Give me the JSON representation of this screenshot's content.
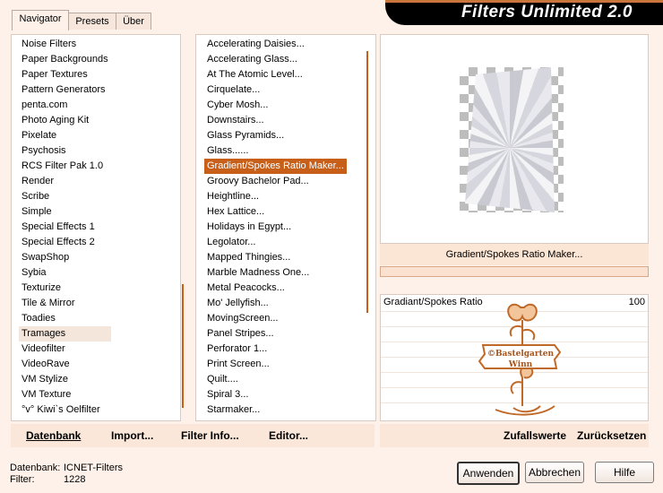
{
  "title": "Filters Unlimited 2.0",
  "tabs": [
    {
      "label": "Navigator",
      "active": true
    },
    {
      "label": "Presets",
      "active": false
    },
    {
      "label": "Über",
      "active": false
    }
  ],
  "categories": [
    "Noise Filters",
    "Paper Backgrounds",
    "Paper Textures",
    "Pattern Generators",
    "penta.com",
    "Photo Aging Kit",
    "Pixelate",
    "Psychosis",
    "RCS Filter Pak 1.0",
    "Render",
    "Scribe",
    "Simple",
    "Special Effects 1",
    "Special Effects 2",
    "SwapShop",
    "Sybia",
    "Texturize",
    "Tile & Mirror",
    "Toadies",
    "Tramages",
    "Videofilter",
    "VideoRave",
    "VM Stylize",
    "VM Texture",
    "°v° Kiwi`s Oelfilter"
  ],
  "selected_category": "Tramages",
  "filters": [
    "Accelerating Daisies...",
    "Accelerating Glass...",
    "At The Atomic Level...",
    "Cirquelate...",
    "Cyber Mosh...",
    "Downstairs...",
    "Glass Pyramids...",
    "Glass......",
    "Gradient/Spokes Ratio Maker...",
    "Groovy Bachelor Pad...",
    "Heightline...",
    "Hex Lattice...",
    "Holidays in Egypt...",
    "Legolator...",
    "Mapped Thingies...",
    "Marble Madness One...",
    "Metal Peacocks...",
    "Mo' Jellyfish...",
    "MovingScreen...",
    "Panel Stripes...",
    "Perforator 1...",
    "Print Screen...",
    "Quilt....",
    "Spiral 3...",
    "Starmaker..."
  ],
  "selected_filter": "Gradient/Spokes Ratio Maker...",
  "preview_filter_name": "Gradient/Spokes Ratio Maker...",
  "parameter": {
    "label": "Gradiant/Spokes Ratio",
    "value": "100"
  },
  "watermark_text": [
    "©Bastelgarten",
    "Winn"
  ],
  "bottom_left_buttons": [
    "Datenbank",
    "Import...",
    "Filter Info...",
    "Editor..."
  ],
  "bottom_right_buttons": [
    "Zufallswerte",
    "Zurücksetzen"
  ],
  "status": {
    "db_label": "Datenbank:",
    "db_value": "ICNET-Filters",
    "filter_label": "Filter:",
    "filter_value": "1228"
  },
  "dialog_buttons": [
    "Anwenden",
    "Abbrechen",
    "Hilfe"
  ],
  "colors": {
    "accent": "#c75f18",
    "background": "#fdf1e9",
    "title_bar": "#000000"
  }
}
